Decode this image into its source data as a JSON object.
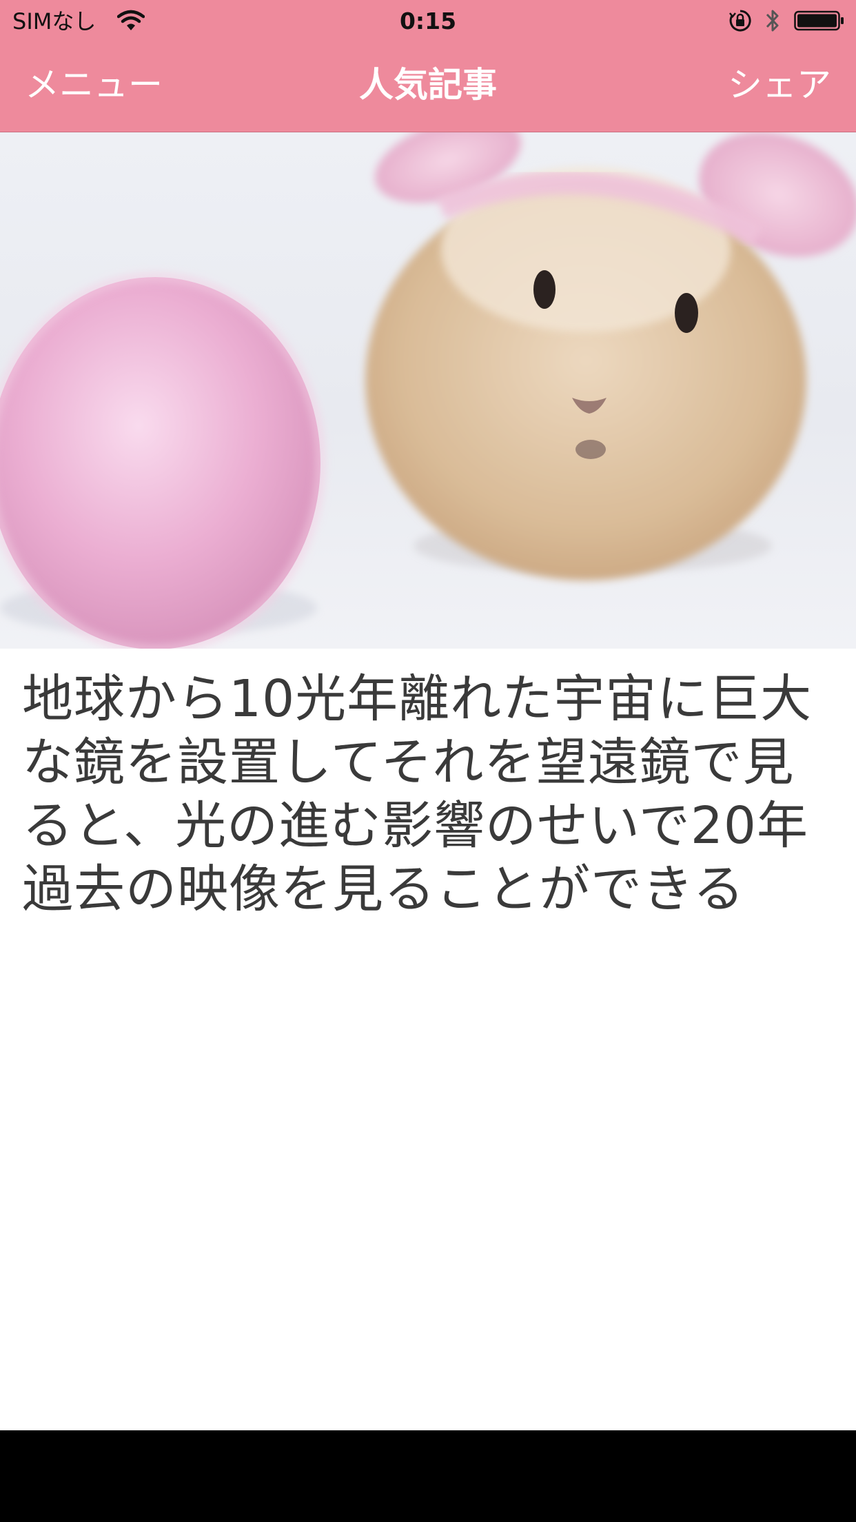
{
  "status_bar": {
    "carrier": "SIMなし",
    "time": "0:15"
  },
  "nav": {
    "left_label": "メニュー",
    "title": "人気記事",
    "right_label": "シェア"
  },
  "article": {
    "title": "地球から10光年離れた宇宙に巨大な鏡を設置してそれを望遠鏡で見ると、光の進む影響のせいで20年過去の映像を見ることができる"
  },
  "colors": {
    "nav_background": "#ee8a9c",
    "nav_text": "#ffffff",
    "article_text": "#3a3a3a",
    "bottom_bar": "#000000"
  },
  "icons": [
    "wifi-icon",
    "rotation-lock-icon",
    "bluetooth-icon",
    "battery-icon"
  ]
}
